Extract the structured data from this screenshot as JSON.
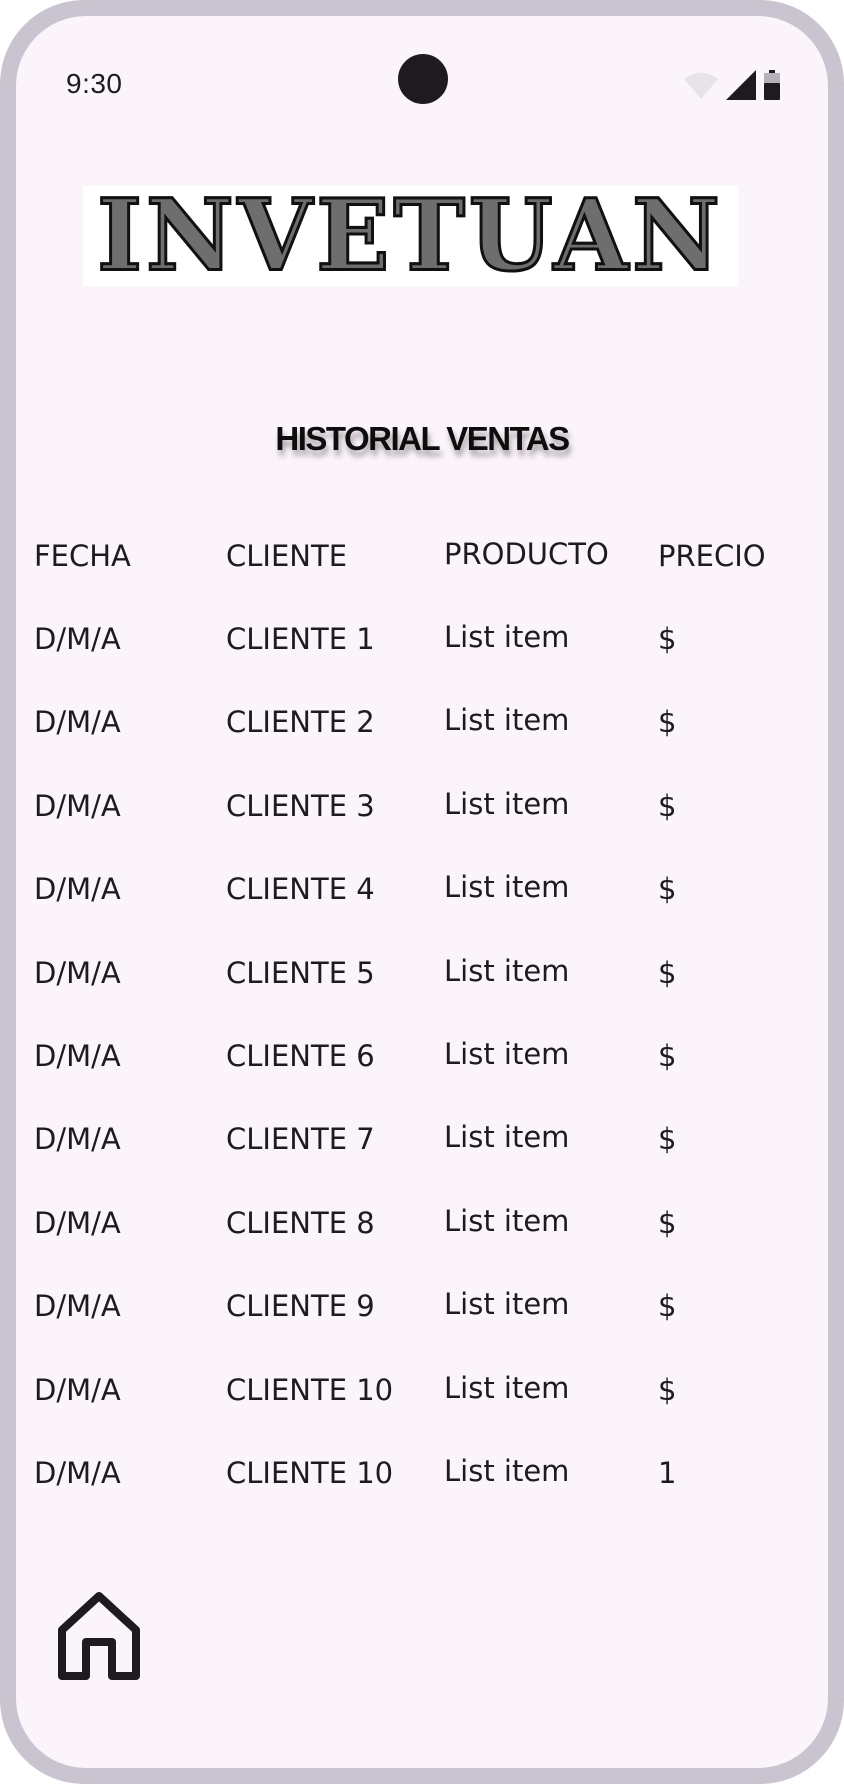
{
  "status_bar": {
    "time": "9:30",
    "icons": [
      "wifi-icon",
      "signal-icon",
      "battery-icon"
    ]
  },
  "logo": {
    "text": "INVETUAN"
  },
  "page_title": "HISTORIAL VENTAS",
  "table": {
    "headers": [
      "FECHA",
      "CLIENTE",
      "PRODUCTO",
      "PRECIO"
    ],
    "rows": [
      [
        "D/M/A",
        "CLIENTE 1",
        "List item",
        "$"
      ],
      [
        "D/M/A",
        "CLIENTE 2",
        "List item",
        "$"
      ],
      [
        "D/M/A",
        "CLIENTE 3",
        "List item",
        "$"
      ],
      [
        "D/M/A",
        "CLIENTE 4",
        "List item",
        "$"
      ],
      [
        "D/M/A",
        "CLIENTE 5",
        "List item",
        "$"
      ],
      [
        "D/M/A",
        "CLIENTE 6",
        "List item",
        "$"
      ],
      [
        "D/M/A",
        "CLIENTE 7",
        "List item",
        "$"
      ],
      [
        "D/M/A",
        "CLIENTE 8",
        "List item",
        "$"
      ],
      [
        "D/M/A",
        "CLIENTE 9",
        "List item",
        "$"
      ],
      [
        "D/M/A",
        "CLIENTE 10",
        "List item",
        "$"
      ],
      [
        "D/M/A",
        "CLIENTE 10",
        "List item",
        "1"
      ]
    ]
  },
  "nav": {
    "home_icon": "home-icon"
  },
  "colors": {
    "frame": "#cac4d0",
    "background": "#fcf4fb",
    "text": "#1d1b20"
  }
}
